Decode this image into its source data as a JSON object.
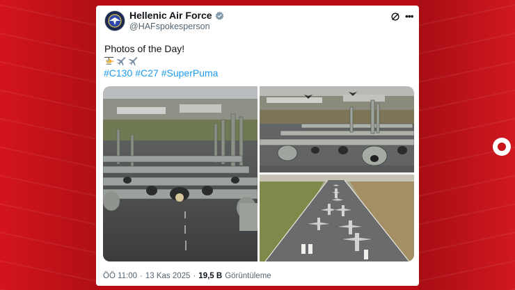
{
  "account": {
    "display_name": "Hellenic Air Force",
    "handle": "@HAFspokesperson"
  },
  "tweet": {
    "text": "Photos of the Day!",
    "emojis": [
      "helicopter-emoji",
      "airplane-emoji",
      "airplane-emoji"
    ],
    "hashtags": [
      "#C130",
      "#C27",
      "#SuperPuma"
    ]
  },
  "meta": {
    "time": "ÖÖ 11:00",
    "separator": "·",
    "date": "13 Kas 2025",
    "views_count": "19,5 B",
    "views_label": "Görüntüleme"
  },
  "colors": {
    "background_red": "#b80d14",
    "link_blue": "#1d9bf0",
    "verified_gray": "#829aab",
    "text_dark": "#0f1419",
    "text_muted": "#536471"
  },
  "icons": [
    "verified-badge-icon",
    "grok-icon",
    "more-options-icon",
    "live-dot-icon"
  ]
}
